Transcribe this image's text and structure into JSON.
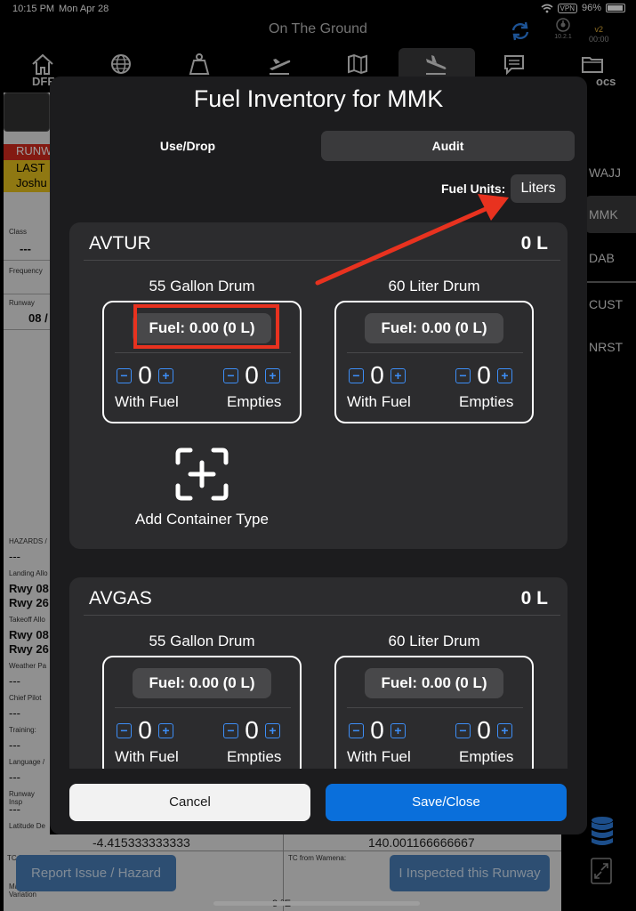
{
  "status_bar": {
    "time": "10:15 PM",
    "date": "Mon Apr 28",
    "vpn": "VPN",
    "battery": "96%"
  },
  "header": {
    "title": "On The Ground",
    "app_version_small": "10.2.1",
    "version": "v2",
    "timer": "00:00"
  },
  "tabs": [
    {
      "icon": "home-icon",
      "label": "DFF"
    },
    {
      "icon": "globe-icon"
    },
    {
      "icon": "weight-icon"
    },
    {
      "icon": "takeoff-icon"
    },
    {
      "icon": "map-icon"
    },
    {
      "icon": "landing-icon"
    },
    {
      "icon": "message-icon"
    },
    {
      "icon": "folder-icon",
      "label": "ocs"
    }
  ],
  "left_panel": {
    "red_text": "RUNW",
    "yellow_line1": "LAST",
    "yellow_line2": "Joshu",
    "fields": [
      {
        "label": "Class",
        "value": "---"
      },
      {
        "label": "Frequency",
        "value": ""
      },
      {
        "label": "Runway",
        "value": "08 /"
      },
      {
        "label": "HAZARDS /",
        "value": "---"
      },
      {
        "label": "Landing Allo",
        "value": "Rwy 08",
        "value2": "Rwy 26"
      },
      {
        "label": "Takeoff Allo",
        "value": "Rwy 08",
        "value2": "Rwy 26"
      },
      {
        "label": "Weather Pa",
        "value": "---"
      },
      {
        "label": "Chief Pilot",
        "value": "---"
      },
      {
        "label": "Training:",
        "value": "---"
      },
      {
        "label": "Language /",
        "value": "---"
      },
      {
        "label": "Runway Insp",
        "value": "---"
      },
      {
        "label": "Latitude De",
        "value": ""
      },
      {
        "label": "",
        "value": ""
      },
      {
        "label": "Mag Variation",
        "value": ""
      }
    ]
  },
  "right_panel": {
    "items": [
      "WAJJ",
      "MMK",
      "DAB",
      "CUST",
      "NRST"
    ],
    "active": "MMK"
  },
  "background_table": {
    "latitude": "-4.415333333333",
    "longitude": "140.001166666667",
    "tc_left": "TC from Sentani:",
    "tc_right": "TC from Wamena:",
    "bottom_text": "3 °E"
  },
  "background_buttons": {
    "report": "Report Issue / Hazard",
    "inspected": "I Inspected this Runway"
  },
  "modal": {
    "title": "Fuel Inventory for MMK",
    "segments": [
      "Use/Drop",
      "Audit"
    ],
    "selected_segment": "Audit",
    "fuel_units_label": "Fuel Units:",
    "fuel_units_value": "Liters",
    "sections": [
      {
        "name": "AVTUR",
        "total": "0 L",
        "containers": [
          {
            "title": "55 Gallon Drum",
            "fuel": "Fuel: 0.00 (0 L)",
            "with_fuel_count": "0",
            "with_fuel_label": "With Fuel",
            "empties_count": "0",
            "empties_label": "Empties"
          },
          {
            "title": "60 Liter Drum",
            "fuel": "Fuel: 0.00 (0 L)",
            "with_fuel_count": "0",
            "with_fuel_label": "With Fuel",
            "empties_count": "0",
            "empties_label": "Empties"
          }
        ],
        "add_label": "Add Container Type"
      },
      {
        "name": "AVGAS",
        "total": "0 L",
        "containers": [
          {
            "title": "55 Gallon Drum",
            "fuel": "Fuel: 0.00 (0 L)",
            "with_fuel_count": "0",
            "with_fuel_label": "With Fuel",
            "empties_count": "0",
            "empties_label": "Empties"
          },
          {
            "title": "60 Liter Drum",
            "fuel": "Fuel: 0.00 (0 L)",
            "with_fuel_count": "0",
            "with_fuel_label": "With Fuel",
            "empties_count": "0",
            "empties_label": "Empties"
          }
        ]
      }
    ],
    "stepper": {
      "minus": "−",
      "plus": "+"
    },
    "cancel": "Cancel",
    "save": "Save/Close"
  },
  "colors": {
    "accent_blue": "#0a6fdb",
    "annotation_red": "#e8321f",
    "stepper_blue": "#3d8ef7",
    "runway_red": "#d42a1e",
    "runway_yellow": "#e7c21d"
  }
}
